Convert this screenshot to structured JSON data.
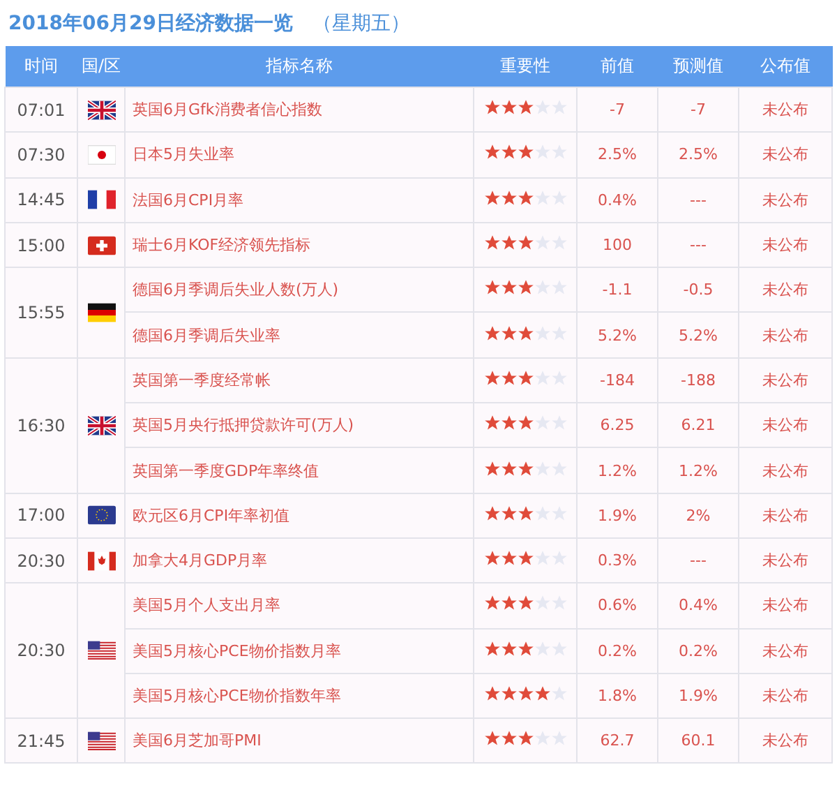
{
  "title": "2018年06月29日经济数据一览",
  "weekday": "（星期五）",
  "table": {
    "columns": [
      "时间",
      "国/区",
      "指标名称",
      "重要性",
      "前值",
      "预测值",
      "公布值"
    ],
    "groups": [
      {
        "time": "07:01",
        "kind": "uk",
        "events": [
          {
            "name": "英国6月Gfk消费者信心指数",
            "stars": 3,
            "previous": "-7",
            "forecast": "-7",
            "actual": "未公布"
          }
        ]
      },
      {
        "time": "07:30",
        "kind": "jp",
        "events": [
          {
            "name": "日本5月失业率",
            "stars": 3,
            "previous": "2.5%",
            "forecast": "2.5%",
            "actual": "未公布"
          }
        ]
      },
      {
        "time": "14:45",
        "kind": "fr",
        "events": [
          {
            "name": "法国6月CPI月率",
            "stars": 3,
            "previous": "0.4%",
            "forecast": "---",
            "actual": "未公布"
          }
        ]
      },
      {
        "time": "15:00",
        "kind": "ch",
        "events": [
          {
            "name": "瑞士6月KOF经济领先指标",
            "stars": 3,
            "previous": "100",
            "forecast": "---",
            "actual": "未公布"
          }
        ]
      },
      {
        "time": "15:55",
        "kind": "de",
        "events": [
          {
            "name": "德国6月季调后失业人数(万人)",
            "stars": 3,
            "previous": "-1.1",
            "forecast": "-0.5",
            "actual": "未公布"
          },
          {
            "name": "德国6月季调后失业率",
            "stars": 3,
            "previous": "5.2%",
            "forecast": "5.2%",
            "actual": "未公布"
          }
        ]
      },
      {
        "time": "16:30",
        "kind": "uk",
        "events": [
          {
            "name": "英国第一季度经常帐",
            "stars": 3,
            "previous": "-184",
            "forecast": "-188",
            "actual": "未公布"
          },
          {
            "name": "英国5月央行抵押贷款许可(万人)",
            "stars": 3,
            "previous": "6.25",
            "forecast": "6.21",
            "actual": "未公布"
          },
          {
            "name": "英国第一季度GDP年率终值",
            "stars": 3,
            "previous": "1.2%",
            "forecast": "1.2%",
            "actual": "未公布"
          }
        ]
      },
      {
        "time": "17:00",
        "kind": "eu",
        "events": [
          {
            "name": "欧元区6月CPI年率初值",
            "stars": 3,
            "previous": "1.9%",
            "forecast": "2%",
            "actual": "未公布"
          }
        ]
      },
      {
        "time": "20:30",
        "kind": "ca",
        "events": [
          {
            "name": "加拿大4月GDP月率",
            "stars": 3,
            "previous": "0.3%",
            "forecast": "---",
            "actual": "未公布"
          }
        ]
      },
      {
        "time": "20:30",
        "kind": "us",
        "events": [
          {
            "name": "美国5月个人支出月率",
            "stars": 3,
            "previous": "0.6%",
            "forecast": "0.4%",
            "actual": "未公布"
          },
          {
            "name": "美国5月核心PCE物价指数月率",
            "stars": 3,
            "previous": "0.2%",
            "forecast": "0.2%",
            "actual": "未公布"
          },
          {
            "name": "美国5月核心PCE物价指数年率",
            "stars": 4,
            "previous": "1.8%",
            "forecast": "1.9%",
            "actual": "未公布"
          }
        ]
      },
      {
        "time": "21:45",
        "kind": "us",
        "events": [
          {
            "name": "美国6月芝加哥PMI",
            "stars": 3,
            "previous": "62.7",
            "forecast": "60.1",
            "actual": "未公布"
          }
        ]
      }
    ]
  }
}
